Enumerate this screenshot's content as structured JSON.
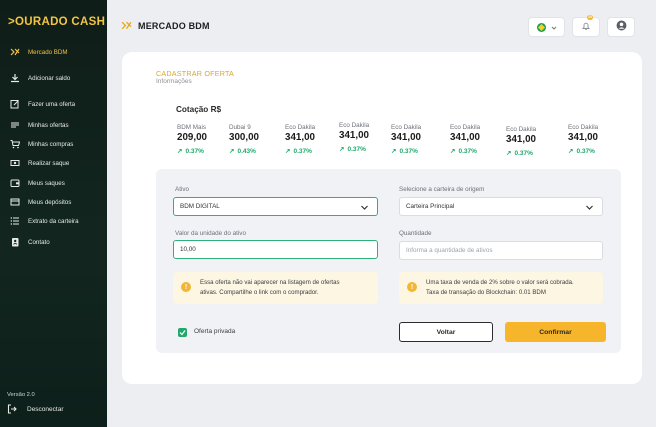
{
  "sidebar": {
    "logo": ">OURADO CASH",
    "items": [
      {
        "label": "Mercado BDM",
        "icon": "exchange-icon",
        "active": true
      },
      {
        "label": "Adicionar saldo",
        "icon": "download-icon"
      },
      {
        "label": "Fazer uma oferta",
        "icon": "edit-icon"
      },
      {
        "label": "Minhas ofertas",
        "icon": "offers-icon"
      },
      {
        "label": "Minhas compras",
        "icon": "cart-icon"
      },
      {
        "label": "Realizar saque",
        "icon": "withdraw-icon"
      },
      {
        "label": "Meus saques",
        "icon": "wallet-icon"
      },
      {
        "label": "Meus depósitos",
        "icon": "deposit-icon"
      },
      {
        "label": "Extrato da carteira",
        "icon": "list-icon"
      },
      {
        "label": "Contato",
        "icon": "contact-icon"
      }
    ],
    "version": "Versão 2.0",
    "logout": "Desconectar"
  },
  "header": {
    "title": "MERCADO BDM",
    "language_flag": "brazil-flag-icon",
    "notification_badge": "10"
  },
  "card": {
    "breadcrumb_title": "CADASTRAR OFERTA",
    "breadcrumb_sub": "Informações",
    "quotes_title": "Cotação R$",
    "quotes": [
      {
        "name": "BDM Mais",
        "price": "209,00",
        "change": "0.37%"
      },
      {
        "name": "Dubai 9",
        "price": "300,00",
        "change": "0.43%"
      },
      {
        "name": "Eco Dakila",
        "price": "341,00",
        "change": "0.37%"
      },
      {
        "name": "Eco Dakila",
        "price": "341,00",
        "change": "0.37%"
      },
      {
        "name": "Eco Dakila",
        "price": "341,00",
        "change": "0.37%"
      },
      {
        "name": "Eco Dakila",
        "price": "341,00",
        "change": "0.37%"
      },
      {
        "name": "Eco Dakila",
        "price": "341,00",
        "change": "0.37%"
      },
      {
        "name": "Eco Dakila",
        "price": "341,00",
        "change": "0.37%"
      }
    ]
  },
  "form": {
    "ativo_label": "Ativo",
    "ativo_value": "BDM DIGITAL",
    "carteira_label": "Selecione a carteira de origem",
    "carteira_value": "Carteira Principal",
    "valor_label": "Valor da unidade do ativo",
    "valor_value": "10,00",
    "quantidade_label": "Quantidade",
    "quantidade_placeholder": "Informa a quantidade de ativos",
    "info_left_line1": "Essa oferta não vai aparecer na listagem de ofertas",
    "info_left_line2": "ativas. Compartilhe o link com o comprador.",
    "info_right_line1": "Uma taxa de venda de 2% sobre o valor será cobrada.",
    "info_right_line2": "Taxa de transação do Blockchain: 0.01 BDM",
    "private_label": "Oferta privada",
    "back_button": "Voltar",
    "confirm_button": "Confirmar"
  },
  "colors": {
    "accent": "#f7b52c",
    "positive": "#1ea96c",
    "sidebar_bg": "#0f1d18"
  }
}
